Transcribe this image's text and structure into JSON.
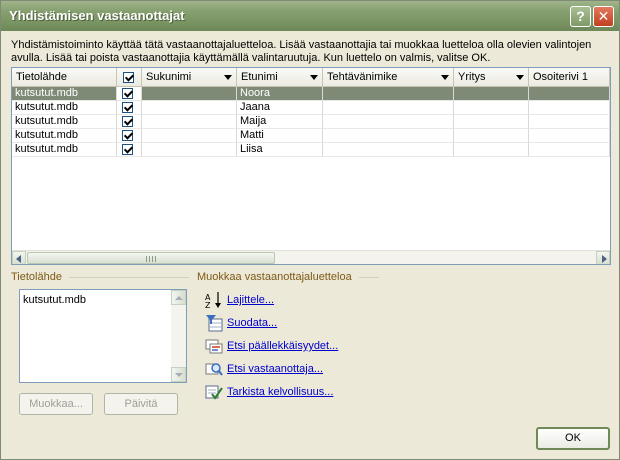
{
  "window": {
    "title": "Yhdistämisen vastaanottajat"
  },
  "description": {
    "line1": "Yhdistämistoiminto käyttää tätä vastaanottajaluetteloa. Lisää vastaanottajia tai muokkaa luetteloa olla olevien valintojen",
    "line2": "avulla. Lisää tai poista vastaanottajia käyttämällä valintaruutuja. Kun luettelo on valmis, valitse OK."
  },
  "table": {
    "columns": [
      "Tietolähde",
      "",
      "Sukunimi",
      "Etunimi",
      "Tehtävänimike",
      "Yritys",
      "Osoiterivi 1"
    ],
    "rows": [
      {
        "source": "kutsutut.mdb",
        "checked": true,
        "sukunimi": "",
        "etunimi": "Noora",
        "selected": true
      },
      {
        "source": "kutsutut.mdb",
        "checked": true,
        "sukunimi": "",
        "etunimi": "Jaana",
        "selected": false
      },
      {
        "source": "kutsutut.mdb",
        "checked": true,
        "sukunimi": "",
        "etunimi": "Maija",
        "selected": false
      },
      {
        "source": "kutsutut.mdb",
        "checked": true,
        "sukunimi": "",
        "etunimi": "Matti",
        "selected": false
      },
      {
        "source": "kutsutut.mdb",
        "checked": true,
        "sukunimi": "",
        "etunimi": "Liisa",
        "selected": false
      }
    ]
  },
  "datasource": {
    "label": "Tietolähde",
    "items": [
      "kutsutut.mdb"
    ],
    "edit_button": "Muokkaa...",
    "refresh_button": "Päivitä"
  },
  "refine": {
    "label": "Muokkaa vastaanottajaluetteloa",
    "links": [
      "Lajittele...",
      "Suodata...",
      "Etsi päällekkäisyydet...",
      "Etsi vastaanottaja...",
      "Tarkista kelvollisuus..."
    ]
  },
  "ok_button": "OK",
  "colors": {
    "title_bar": "#869f6f",
    "selection": "#7e8a76",
    "group_label": "#7e5a17",
    "link": "#0000cc"
  }
}
